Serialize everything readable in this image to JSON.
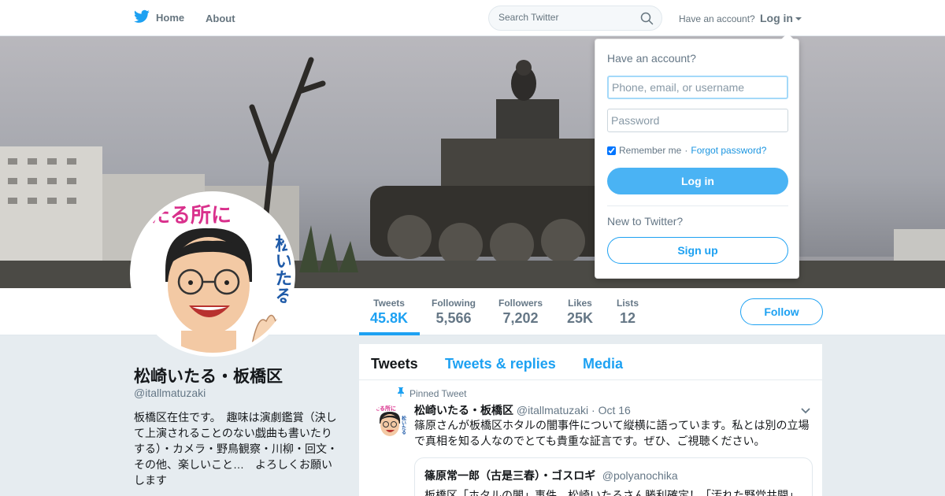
{
  "topbar": {
    "home_label": "Home",
    "about_label": "About",
    "search_placeholder": "Search Twitter",
    "have_account": "Have an account?",
    "login_label": "Log in"
  },
  "profile": {
    "name": "松崎いたる・板橋区",
    "handle": "@itallmatuzaki",
    "bio": "板橋区在住です。　趣味は演劇鑑賞（決して上演されることのない戯曲も書いたりする）・カメラ・野鳥観察・川柳・回文・その他、楽しいこと…　よろしくお願いします",
    "avatar_text_top": "たる所に",
    "avatar_text_side": "松いたる"
  },
  "stats": [
    {
      "label": "Tweets",
      "value": "45.8K"
    },
    {
      "label": "Following",
      "value": "5,566"
    },
    {
      "label": "Followers",
      "value": "7,202"
    },
    {
      "label": "Likes",
      "value": "25K"
    },
    {
      "label": "Lists",
      "value": "12"
    }
  ],
  "follow_label": "Follow",
  "timeline": {
    "tabs": [
      "Tweets",
      "Tweets & replies",
      "Media"
    ]
  },
  "tweet": {
    "pinned_label": "Pinned Tweet",
    "fullname": "松崎いたる・板橋区",
    "username": "@itallmatuzaki",
    "separator": "·",
    "time": "Oct 16",
    "text": "篠原さんが板橋区ホタルの闇事件について縦横に語っています。私とは別の立場で真相を知る人なのでとても貴重な証言です。ぜひ、ご視聴ください。",
    "quote": {
      "name": "篠原常一郎（古是三春）・ゴスロギ",
      "handle": "@polyanochika",
      "text": "板橋区「ホタルの闇」事件、松崎いたるさん勝利確定！「汚れた野党共闘」"
    }
  },
  "login_dropdown": {
    "title": "Have an account?",
    "username_placeholder": "Phone, email, or username",
    "password_placeholder": "Password",
    "remember_label": "Remember me",
    "separator": "·",
    "forgot_label": "Forgot password?",
    "login_button": "Log in",
    "new_label": "New to Twitter?",
    "signup_button": "Sign up"
  },
  "colors": {
    "accent": "#1da1f2",
    "background": "#e6ecf0",
    "login_button": "#4ab3f4"
  },
  "icons": [
    "twitter-bird-icon",
    "search-icon",
    "chevron-down-icon",
    "pin-icon"
  ]
}
